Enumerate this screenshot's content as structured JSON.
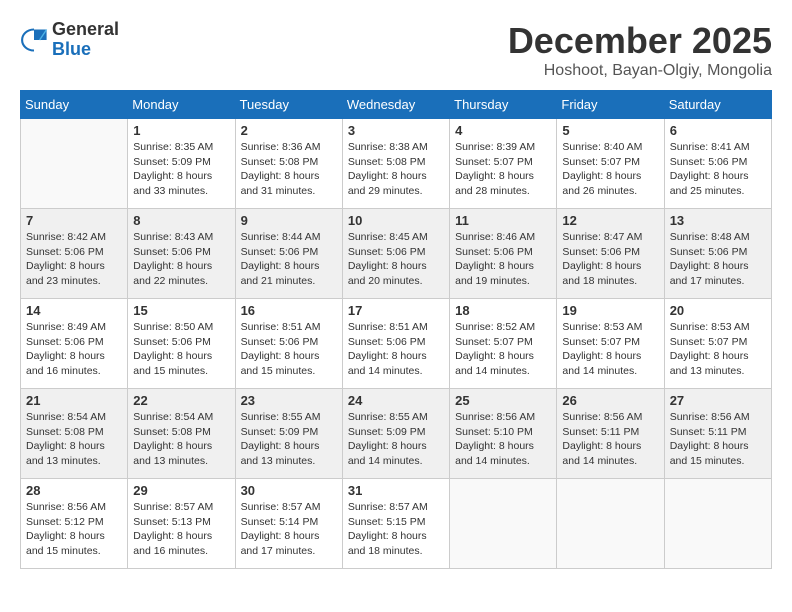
{
  "logo": {
    "general": "General",
    "blue": "Blue"
  },
  "title": {
    "month": "December 2025",
    "location": "Hoshoot, Bayan-Olgiy, Mongolia"
  },
  "days_header": [
    "Sunday",
    "Monday",
    "Tuesday",
    "Wednesday",
    "Thursday",
    "Friday",
    "Saturday"
  ],
  "weeks": [
    [
      {
        "day": "",
        "info": ""
      },
      {
        "day": "1",
        "info": "Sunrise: 8:35 AM\nSunset: 5:09 PM\nDaylight: 8 hours\nand 33 minutes."
      },
      {
        "day": "2",
        "info": "Sunrise: 8:36 AM\nSunset: 5:08 PM\nDaylight: 8 hours\nand 31 minutes."
      },
      {
        "day": "3",
        "info": "Sunrise: 8:38 AM\nSunset: 5:08 PM\nDaylight: 8 hours\nand 29 minutes."
      },
      {
        "day": "4",
        "info": "Sunrise: 8:39 AM\nSunset: 5:07 PM\nDaylight: 8 hours\nand 28 minutes."
      },
      {
        "day": "5",
        "info": "Sunrise: 8:40 AM\nSunset: 5:07 PM\nDaylight: 8 hours\nand 26 minutes."
      },
      {
        "day": "6",
        "info": "Sunrise: 8:41 AM\nSunset: 5:06 PM\nDaylight: 8 hours\nand 25 minutes."
      }
    ],
    [
      {
        "day": "7",
        "info": "Sunrise: 8:42 AM\nSunset: 5:06 PM\nDaylight: 8 hours\nand 23 minutes."
      },
      {
        "day": "8",
        "info": "Sunrise: 8:43 AM\nSunset: 5:06 PM\nDaylight: 8 hours\nand 22 minutes."
      },
      {
        "day": "9",
        "info": "Sunrise: 8:44 AM\nSunset: 5:06 PM\nDaylight: 8 hours\nand 21 minutes."
      },
      {
        "day": "10",
        "info": "Sunrise: 8:45 AM\nSunset: 5:06 PM\nDaylight: 8 hours\nand 20 minutes."
      },
      {
        "day": "11",
        "info": "Sunrise: 8:46 AM\nSunset: 5:06 PM\nDaylight: 8 hours\nand 19 minutes."
      },
      {
        "day": "12",
        "info": "Sunrise: 8:47 AM\nSunset: 5:06 PM\nDaylight: 8 hours\nand 18 minutes."
      },
      {
        "day": "13",
        "info": "Sunrise: 8:48 AM\nSunset: 5:06 PM\nDaylight: 8 hours\nand 17 minutes."
      }
    ],
    [
      {
        "day": "14",
        "info": "Sunrise: 8:49 AM\nSunset: 5:06 PM\nDaylight: 8 hours\nand 16 minutes."
      },
      {
        "day": "15",
        "info": "Sunrise: 8:50 AM\nSunset: 5:06 PM\nDaylight: 8 hours\nand 15 minutes."
      },
      {
        "day": "16",
        "info": "Sunrise: 8:51 AM\nSunset: 5:06 PM\nDaylight: 8 hours\nand 15 minutes."
      },
      {
        "day": "17",
        "info": "Sunrise: 8:51 AM\nSunset: 5:06 PM\nDaylight: 8 hours\nand 14 minutes."
      },
      {
        "day": "18",
        "info": "Sunrise: 8:52 AM\nSunset: 5:07 PM\nDaylight: 8 hours\nand 14 minutes."
      },
      {
        "day": "19",
        "info": "Sunrise: 8:53 AM\nSunset: 5:07 PM\nDaylight: 8 hours\nand 14 minutes."
      },
      {
        "day": "20",
        "info": "Sunrise: 8:53 AM\nSunset: 5:07 PM\nDaylight: 8 hours\nand 13 minutes."
      }
    ],
    [
      {
        "day": "21",
        "info": "Sunrise: 8:54 AM\nSunset: 5:08 PM\nDaylight: 8 hours\nand 13 minutes."
      },
      {
        "day": "22",
        "info": "Sunrise: 8:54 AM\nSunset: 5:08 PM\nDaylight: 8 hours\nand 13 minutes."
      },
      {
        "day": "23",
        "info": "Sunrise: 8:55 AM\nSunset: 5:09 PM\nDaylight: 8 hours\nand 13 minutes."
      },
      {
        "day": "24",
        "info": "Sunrise: 8:55 AM\nSunset: 5:09 PM\nDaylight: 8 hours\nand 14 minutes."
      },
      {
        "day": "25",
        "info": "Sunrise: 8:56 AM\nSunset: 5:10 PM\nDaylight: 8 hours\nand 14 minutes."
      },
      {
        "day": "26",
        "info": "Sunrise: 8:56 AM\nSunset: 5:11 PM\nDaylight: 8 hours\nand 14 minutes."
      },
      {
        "day": "27",
        "info": "Sunrise: 8:56 AM\nSunset: 5:11 PM\nDaylight: 8 hours\nand 15 minutes."
      }
    ],
    [
      {
        "day": "28",
        "info": "Sunrise: 8:56 AM\nSunset: 5:12 PM\nDaylight: 8 hours\nand 15 minutes."
      },
      {
        "day": "29",
        "info": "Sunrise: 8:57 AM\nSunset: 5:13 PM\nDaylight: 8 hours\nand 16 minutes."
      },
      {
        "day": "30",
        "info": "Sunrise: 8:57 AM\nSunset: 5:14 PM\nDaylight: 8 hours\nand 17 minutes."
      },
      {
        "day": "31",
        "info": "Sunrise: 8:57 AM\nSunset: 5:15 PM\nDaylight: 8 hours\nand 18 minutes."
      },
      {
        "day": "",
        "info": ""
      },
      {
        "day": "",
        "info": ""
      },
      {
        "day": "",
        "info": ""
      }
    ]
  ]
}
